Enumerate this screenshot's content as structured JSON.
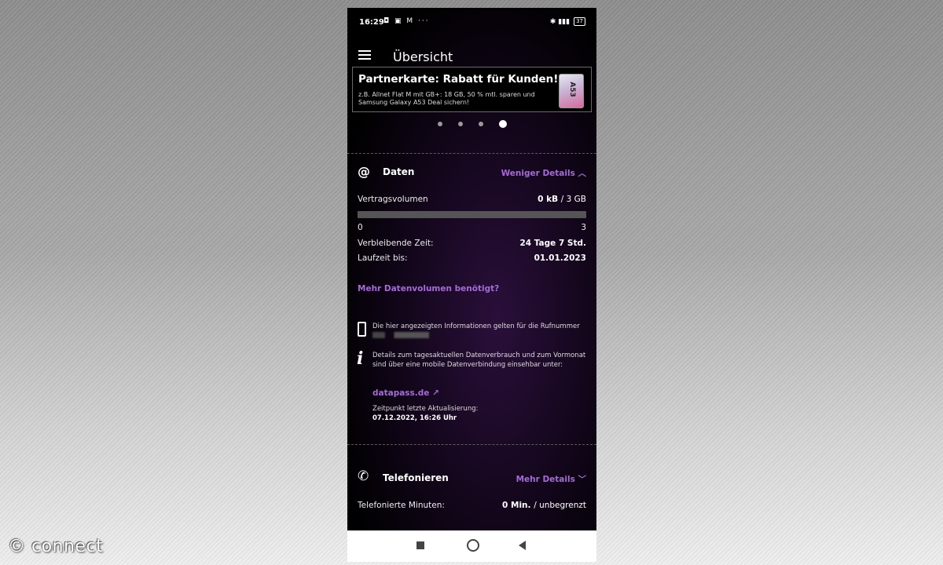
{
  "statusbar": {
    "time": "16:29",
    "left_icons": "◘ ▣ M ···",
    "right_icons": "✱ ▮▮▮",
    "battery": "37"
  },
  "header": {
    "title": "Übersicht"
  },
  "banner": {
    "title": "Partnerkarte: Rabatt für Kunden!",
    "text": "z.B. Allnet Flat M mit GB+: 18 GB, 50 % mtl. sparen und Samsung Galaxy A53 Deal sichern!",
    "slides": 4,
    "active_slide": 4
  },
  "daten": {
    "icon": "at-icon",
    "title": "Daten",
    "toggle_label": "Weniger Details",
    "volume_label": "Vertragsvolumen",
    "volume_used": "0 kB",
    "volume_total": "/ 3 GB",
    "progress_fraction": 0,
    "scale_min": "0",
    "scale_max": "3",
    "remaining_label": "Verbleibende Zeit:",
    "remaining_value": "24 Tage 7 Std.",
    "runtime_label": "Laufzeit bis:",
    "runtime_value": "01.01.2023",
    "more_volume_link": "Mehr Datenvolumen benötigt?",
    "info_number_text": "Die hier angezeigten Informationen gelten für die Rufnummer",
    "info_details_text": "Details zum tagesaktuellen Datenverbrauch und zum Vormonat sind über eine mobile Datenverbindung einsehbar unter:",
    "datapass_link": "datapass.de",
    "update_label": "Zeitpunkt letzte Aktualisierung:",
    "update_value": "07.12.2022, 16:26 Uhr"
  },
  "telefonieren": {
    "icon": "phone-icon",
    "title": "Telefonieren",
    "toggle_label": "Mehr Details",
    "minutes_label": "Telefonierte Minuten:",
    "minutes_value": "0 Min.",
    "minutes_limit": "/ unbegrenzt"
  },
  "watermark": "© connect",
  "colors": {
    "accent": "#a56bd8",
    "background": "#000000"
  }
}
